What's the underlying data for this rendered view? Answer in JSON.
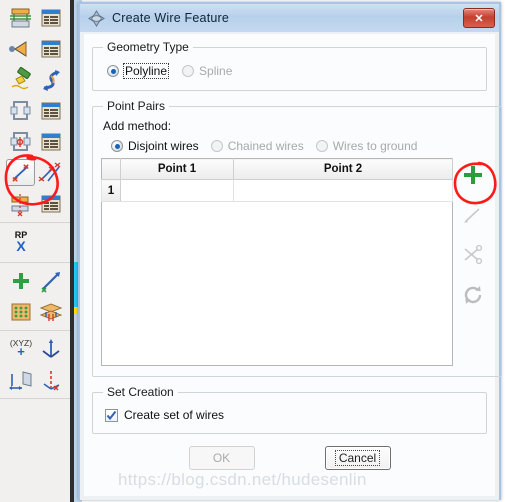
{
  "window": {
    "title": "Create Wire Feature",
    "title_icon": "wire-feature-icon",
    "close_label": "✕"
  },
  "geometry_type": {
    "legend": "Geometry Type",
    "options": [
      {
        "label": "Polyline",
        "checked": true,
        "disabled": false,
        "focused": true
      },
      {
        "label": "Spline",
        "checked": false,
        "disabled": true,
        "focused": false
      }
    ]
  },
  "point_pairs": {
    "legend": "Point Pairs",
    "add_method_label": "Add method:",
    "add_methods": [
      {
        "label": "Disjoint wires",
        "checked": true,
        "disabled": false
      },
      {
        "label": "Chained wires",
        "checked": false,
        "disabled": true
      },
      {
        "label": "Wires to ground",
        "checked": false,
        "disabled": true
      }
    ],
    "table": {
      "corner_header": "",
      "columns": [
        "Point 1",
        "Point 2"
      ],
      "rows": [
        {
          "index": "1",
          "point1": "",
          "point2": ""
        }
      ]
    },
    "tools": [
      {
        "name": "add-point-pair-icon",
        "glyph": "+",
        "color": "#2a9d3d",
        "enabled": true
      },
      {
        "name": "select-wire-icon",
        "glyph": "line",
        "color": "#c8c8c8",
        "enabled": false
      },
      {
        "name": "cut-wire-icon",
        "glyph": "cut",
        "color": "#c8c8c8",
        "enabled": false
      },
      {
        "name": "refresh-icon",
        "glyph": "refresh",
        "color": "#bcbcbc",
        "enabled": false
      }
    ]
  },
  "set_creation": {
    "legend": "Set Creation",
    "checkbox": {
      "label": "Create set of wires",
      "checked": true
    }
  },
  "buttons": {
    "ok": {
      "label": "OK",
      "disabled": true
    },
    "cancel": {
      "label": "Cancel",
      "disabled": false,
      "focused": true
    }
  },
  "watermark": {
    "text": "https://blog.csdn.net/hudesenlin"
  },
  "toolbar": {
    "items": [
      {
        "name": "toolbar-icon-layered-block",
        "row": 1,
        "col": 1
      },
      {
        "name": "toolbar-icon-table-1",
        "row": 1,
        "col": 2
      },
      {
        "name": "toolbar-icon-cone-probe",
        "row": 2,
        "col": 1
      },
      {
        "name": "toolbar-icon-table-2",
        "row": 2,
        "col": 2
      },
      {
        "name": "toolbar-icon-flashlight",
        "row": 3,
        "col": 1
      },
      {
        "name": "toolbar-icon-twisted-arrow",
        "row": 3,
        "col": 2
      },
      {
        "name": "toolbar-icon-frame-shape",
        "row": 4,
        "col": 1
      },
      {
        "name": "toolbar-icon-table-3",
        "row": 4,
        "col": 2
      },
      {
        "name": "toolbar-icon-frame-point",
        "row": 5,
        "col": 1
      },
      {
        "name": "toolbar-icon-table-4",
        "row": 5,
        "col": 2
      },
      {
        "name": "toolbar-icon-create-wire-feature",
        "row": 6,
        "col": 1,
        "selected": true
      },
      {
        "name": "toolbar-icon-multi-wire",
        "row": 6,
        "col": 2
      },
      {
        "name": "toolbar-icon-plate-point",
        "row": 7,
        "col": 1
      },
      {
        "name": "toolbar-icon-table-5",
        "row": 7,
        "col": 2
      },
      {
        "name": "toolbar-icon-rp-x",
        "row": 8,
        "col": 1,
        "label": "RP"
      },
      {
        "name": "toolbar-icon-add-point",
        "row": 9,
        "col": 1
      },
      {
        "name": "toolbar-icon-arrow-pen",
        "row": 9,
        "col": 2
      },
      {
        "name": "toolbar-icon-point-grid",
        "row": 10,
        "col": 1
      },
      {
        "name": "toolbar-icon-mesh-layers",
        "row": 10,
        "col": 2
      },
      {
        "name": "toolbar-icon-xyz-coord",
        "row": 11,
        "col": 1,
        "label": "(XYZ)"
      },
      {
        "name": "toolbar-icon-axis-triad",
        "row": 11,
        "col": 2
      },
      {
        "name": "toolbar-icon-plane-axis",
        "row": 12,
        "col": 1
      },
      {
        "name": "toolbar-icon-axis-points",
        "row": 12,
        "col": 2
      }
    ],
    "rp_label": "RP",
    "xyz_label": "(XYZ)"
  },
  "annotations": {
    "toolbar_circle": "red-ellipse-around-wire-tool",
    "plus_circle": "red-ellipse-around-add-button"
  }
}
